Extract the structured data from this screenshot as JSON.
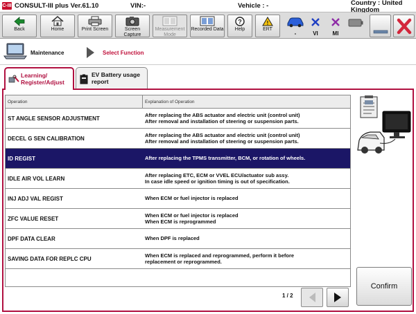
{
  "titlebar": {
    "logo": "C-III",
    "app_title": "CONSULT-III plus  Ver.61.10",
    "vin_label": "VIN:-",
    "vehicle_label": "Vehicle : -",
    "country": "Country : United Kingdom"
  },
  "toolbar": {
    "back": "Back",
    "home": "Home",
    "print": "Print Screen",
    "capture": "Screen Capture",
    "measurement": "Measurement Mode",
    "recorded": "Recorded Data",
    "help": "Help",
    "ert": "ERT",
    "status_dash": "-",
    "status_vi": "VI",
    "status_mi": "MI"
  },
  "breadcrumb": {
    "maintenance": "Maintenance",
    "select_function": "Select Function"
  },
  "tabs": [
    {
      "label": "Learning/ Register/Adjust",
      "active": true
    },
    {
      "label": "EV Battery usage report",
      "active": false
    }
  ],
  "table": {
    "headers": [
      "Operation",
      "Explanation of Operation"
    ],
    "rows": [
      {
        "operation": "ST ANGLE SENSOR ADJUSTMENT",
        "explanation": "After replacing the ABS actuator and electric unit (control unit)\nAfter removal and installation of steering or suspension parts."
      },
      {
        "operation": "DECEL G SEN CALIBRATION",
        "explanation": "After replacing the ABS actuator and electric unit (control unit)\nAfter removal and installation of steering or suspension parts."
      },
      {
        "operation": "ID REGIST",
        "explanation": "After replacing the TPMS transmitter, BCM, or rotation of wheels.",
        "selected": true
      },
      {
        "operation": "IDLE AIR VOL LEARN",
        "explanation": "After replacing ETC, ECM or VVEL ECU/actuator sub assy.\nIn case idle speed or ignition timing is out of specification."
      },
      {
        "operation": "INJ ADJ VAL REGIST",
        "explanation": "When ECM or fuel injector is replaced"
      },
      {
        "operation": "ZFC VALUE RESET",
        "explanation": "When ECM or fuel injector is replaced\nWhen ECM is reprogrammed"
      },
      {
        "operation": "DPF DATA CLEAR",
        "explanation": "When DPF is replaced"
      },
      {
        "operation": "SAVING DATA FOR REPLC CPU",
        "explanation": "When ECM is replaced and reprogrammed, perform it before\nreplacement or reprogrammed."
      }
    ]
  },
  "pager": {
    "text": "1 / 2"
  },
  "confirm_label": "Confirm",
  "colors": {
    "accent": "#b01040",
    "selected_row": "#1b1666",
    "crumb_active": "#c0113b"
  }
}
